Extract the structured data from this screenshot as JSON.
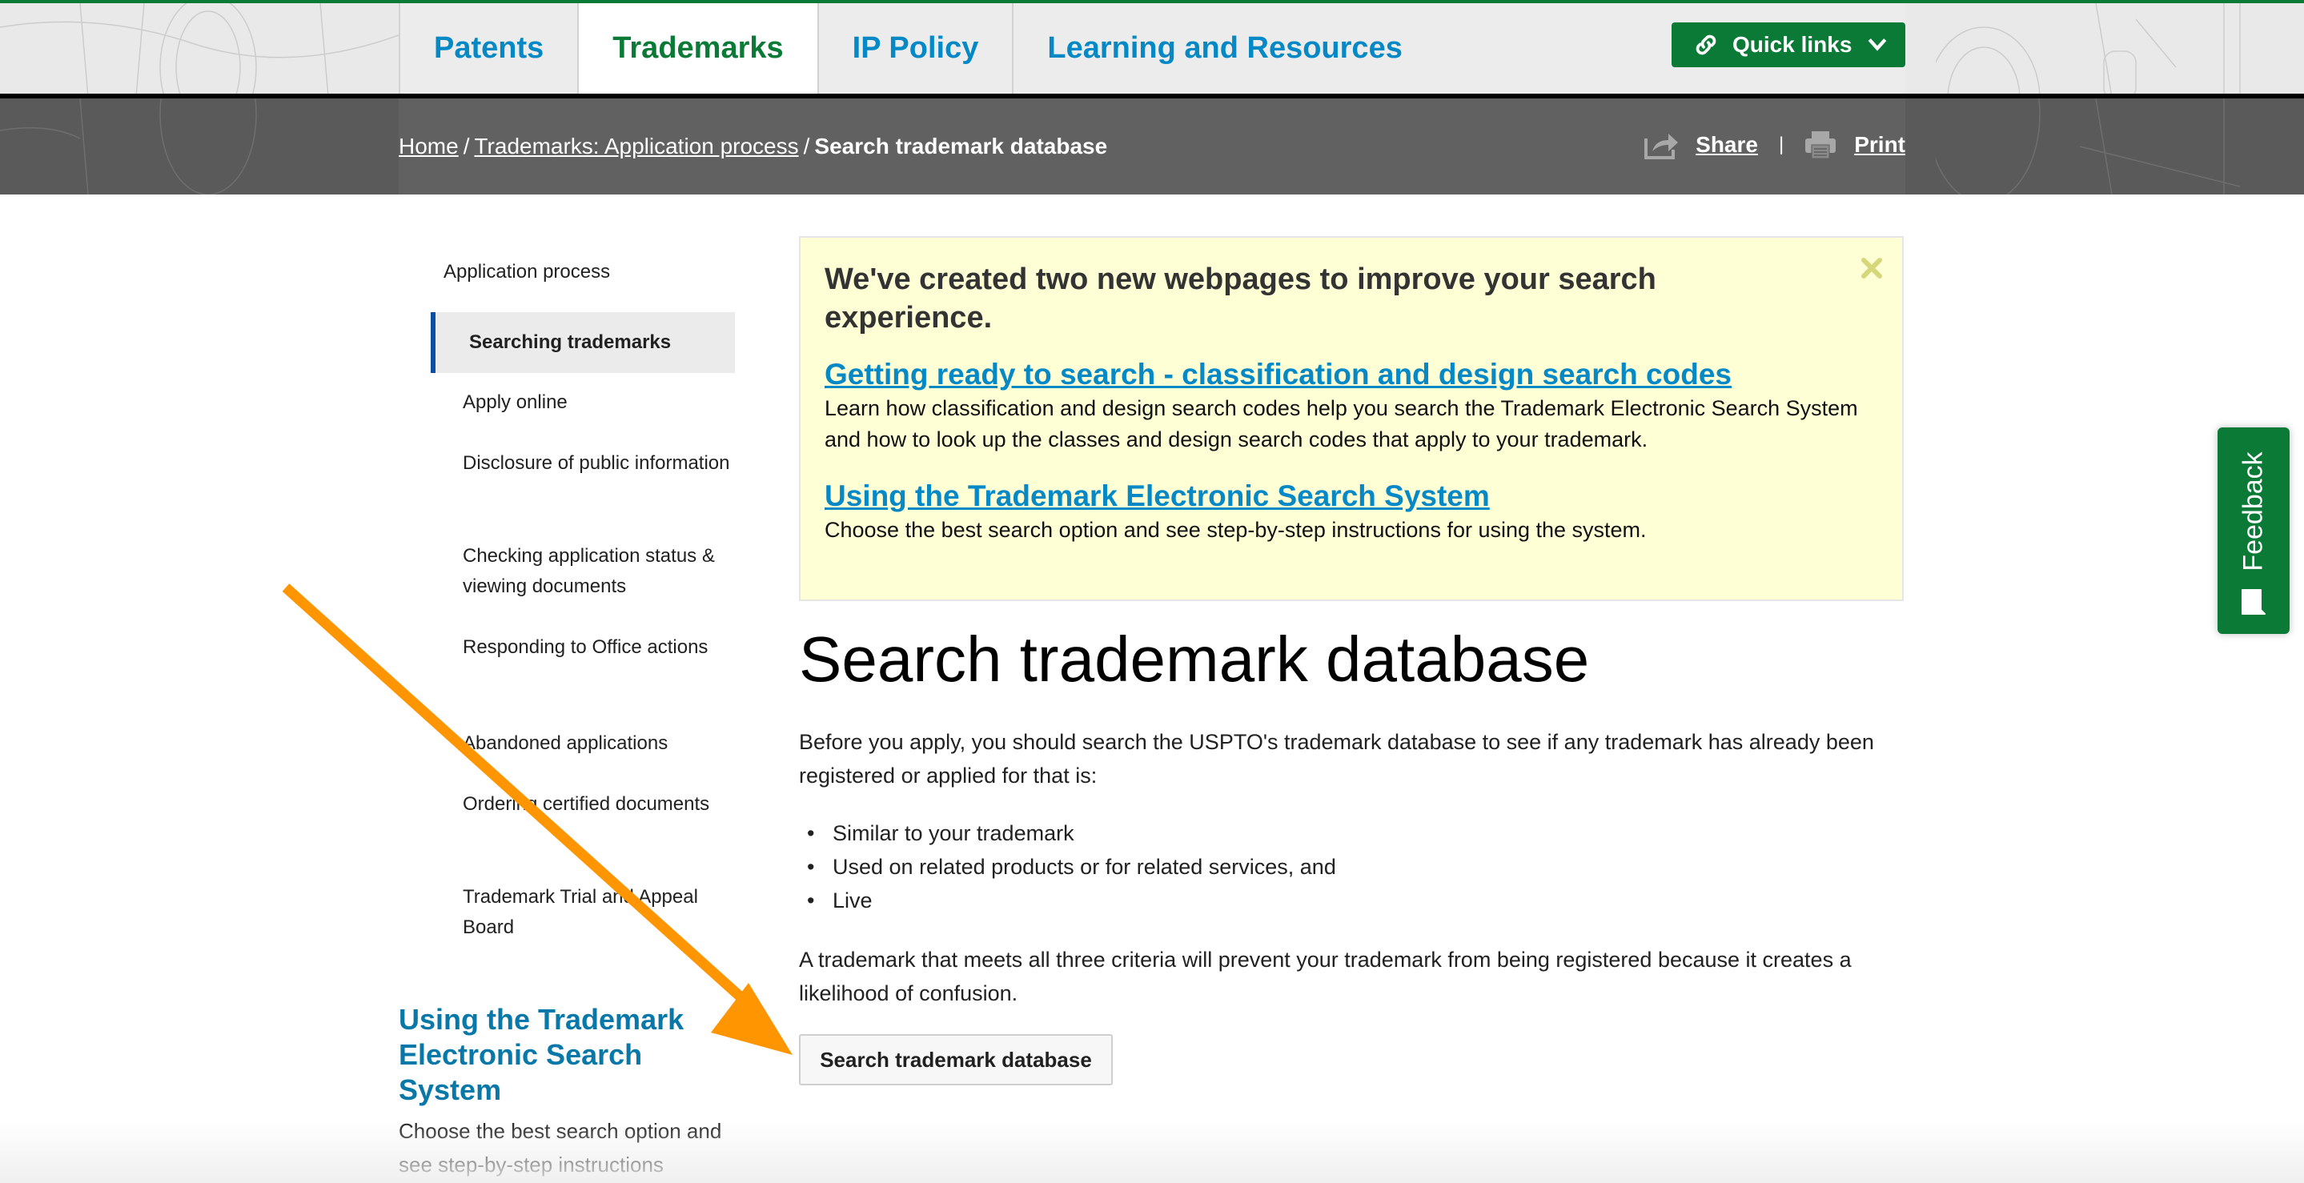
{
  "nav": {
    "tabs": [
      {
        "label": "Patents",
        "active": false
      },
      {
        "label": "Trademarks",
        "active": true
      },
      {
        "label": "IP Policy",
        "active": false
      },
      {
        "label": "Learning and Resources",
        "active": false
      }
    ],
    "quick_links_label": "Quick links"
  },
  "breadcrumb": {
    "items": [
      {
        "label": "Home",
        "link": true
      },
      {
        "label": "Trademarks: Application process",
        "link": true
      },
      {
        "label": "Search trademark database",
        "link": false
      }
    ],
    "separator": "/",
    "share_label": "Share",
    "print_label": "Print",
    "pipe": "|"
  },
  "sidebar": {
    "parent": "Application process",
    "items": [
      {
        "label": "Searching trademarks",
        "active": true
      },
      {
        "label": "Apply online",
        "active": false
      },
      {
        "label": "Disclosure of public information",
        "active": false
      },
      {
        "label": "Checking application status & viewing documents",
        "active": false
      },
      {
        "label": "Responding to Office actions",
        "active": false
      },
      {
        "label": "Abandoned applications",
        "active": false
      },
      {
        "label": "Ordering certified documents",
        "active": false
      },
      {
        "label": "Trademark Trial and Appeal Board",
        "active": false
      }
    ],
    "promo_heading": "Using the Trademark Electronic Search System",
    "promo_text": "Choose the best search option and see step-by-step instructions"
  },
  "notice": {
    "title": "We've created two new webpages to improve your search experience.",
    "links": [
      {
        "label": "Getting ready to search - classification and design search codes",
        "description": "Learn how classification and design search codes help you search the Trademark Electronic Search System and how to look up the classes and design search codes that apply to your trademark."
      },
      {
        "label": "Using the Trademark Electronic Search System",
        "description": "Choose the best search option and see step-by-step instructions for using the system."
      }
    ]
  },
  "main": {
    "title": "Search trademark database",
    "intro": "Before you apply, you should search the USPTO's trademark database to see if any trademark has already been registered or applied for that is:",
    "criteria": [
      "Similar to your trademark",
      "Used on related products or for related services, and",
      "Live"
    ],
    "conclusion": "A trademark that meets all three criteria will prevent your trademark from being registered because it creates a likelihood of confusion.",
    "button_label": "Search trademark database"
  },
  "feedback": {
    "label": "Feedback"
  },
  "colors": {
    "brand_green": "#0a7a36",
    "link_blue": "#0588c6",
    "heading_blue": "#0878a8",
    "active_marker": "#0b4ea2",
    "notice_bg": "#ffffd6",
    "annotation_arrow": "#ff9500"
  }
}
